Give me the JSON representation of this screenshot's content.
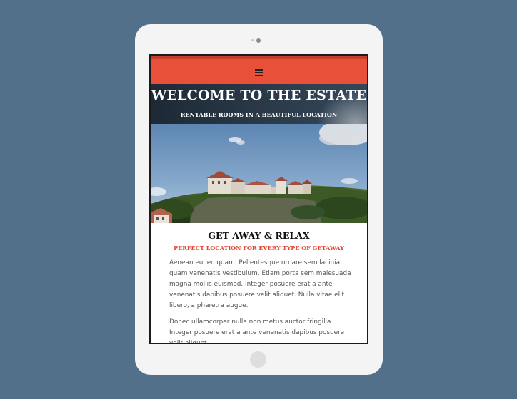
{
  "hero": {
    "title": "WELCOME TO THE ESTATE",
    "subtitle": "RENTABLE ROOMS IN A BEAUTIFUL LOCATION"
  },
  "nav": {
    "menu_icon": "hamburger-menu-icon"
  },
  "section": {
    "title": "GET AWAY & RELAX",
    "subtitle": "PERFECT LOCATION FOR EVERY TYPE OF GETAWAY",
    "paragraphs": [
      "Aenean eu leo quam. Pellentesque ornare sem lacinia quam venenatis vestibulum. Etiam porta sem malesuada magna mollis euismod. Integer posuere erat a ante venenatis dapibus posuere velit aliquet. Nulla vitae elit libero, a pharetra augue.",
      "Donec ullamcorper nulla non metus auctor fringilla. Integer posuere erat a ante venenatis dapibus posuere velit aliquet."
    ]
  },
  "colors": {
    "background": "#527089",
    "accent": "#e9503a",
    "accent_text": "#e14634"
  }
}
